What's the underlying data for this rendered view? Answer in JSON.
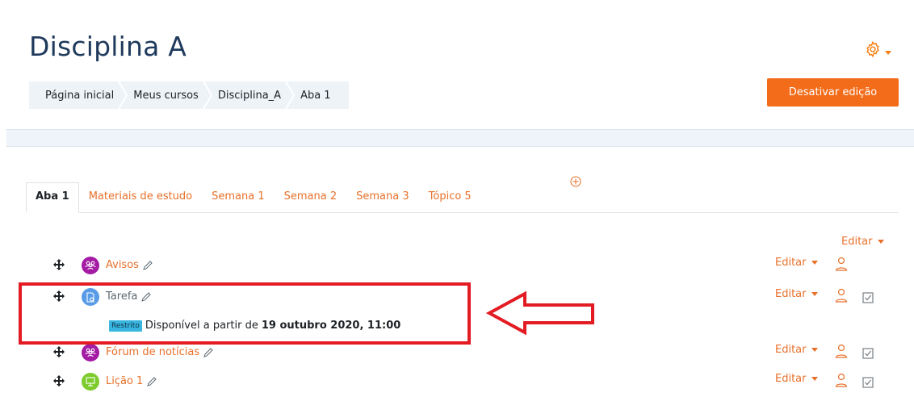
{
  "page": {
    "title": "Disciplina A"
  },
  "header": {
    "settings_icon": "gear-icon",
    "accent": "#f98012"
  },
  "breadcrumb": [
    {
      "label": "Página inicial"
    },
    {
      "label": "Meus cursos"
    },
    {
      "label": "Disciplina_A"
    },
    {
      "label": "Aba 1"
    }
  ],
  "edit_button": {
    "label": "Desativar edição",
    "color": "#f36c1a"
  },
  "tabs": [
    {
      "label": "Aba 1",
      "active": true
    },
    {
      "label": "Materiais de estudo"
    },
    {
      "label": "Semana 1"
    },
    {
      "label": "Semana 2"
    },
    {
      "label": "Semana 3"
    },
    {
      "label": "Tópico 5"
    }
  ],
  "section": {
    "edit_label": "Editar"
  },
  "activities": [
    {
      "name": "Avisos",
      "icon": "forum-icon",
      "icon_color": "#a31ca3",
      "edit_label": "Editar",
      "has_check": false
    },
    {
      "name": "Tarefa",
      "icon": "assignment-icon",
      "icon_color": "#5a9be8",
      "edit_label": "Editar",
      "has_check": true
    },
    {
      "name": "Fórum de notícias",
      "icon": "forum-icon",
      "icon_color": "#a31ca3",
      "edit_label": "Editar",
      "has_check": true
    },
    {
      "name": "Lição 1",
      "icon": "lesson-icon",
      "icon_color": "#7dcb2c",
      "edit_label": "Editar",
      "has_check": true
    }
  ],
  "restriction": {
    "badge": "Restrito",
    "text": "Disponível a partir de",
    "date": "19 outubro 2020, 11:00"
  },
  "annotation": {
    "box_color": "#e31b23"
  }
}
